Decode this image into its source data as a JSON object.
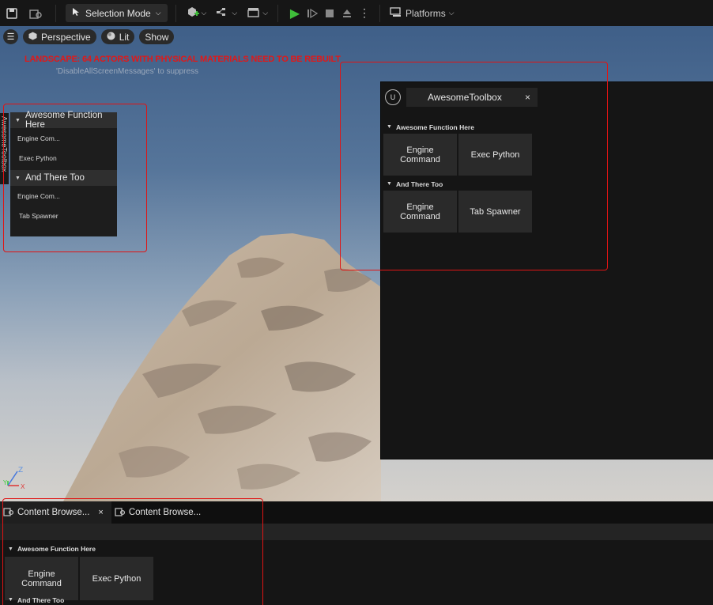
{
  "toolbar": {
    "mode_label": "Selection Mode",
    "platforms_label": "Platforms"
  },
  "viewport": {
    "perspective_label": "Perspective",
    "lit_label": "Lit",
    "show_label": "Show",
    "warning": "LANDSCAPE: 64 ACTORS WITH PHYSICAL MATERIALS NEED TO BE REBUILT",
    "warning_sub": "'DisableAllScreenMessages' to suppress",
    "side_tab_label": "AwesomeToolbox",
    "axis_z": "Z",
    "axis_y": "Y",
    "axis_x": "X"
  },
  "mini_panel": {
    "section1": "Awesome Function Here",
    "items1": [
      "Engine Com...",
      "Exec Python"
    ],
    "section2": "And There Too",
    "items2": [
      "Engine Com...",
      "Tab Spawner"
    ]
  },
  "float_window": {
    "tab_title": "AwesomeToolbox",
    "close": "×",
    "section1": "Awesome Function Here",
    "buttons1": [
      "Engine\nCommand",
      "Exec Python"
    ],
    "section2": "And There Too",
    "buttons2": [
      "Engine\nCommand",
      "Tab Spawner"
    ]
  },
  "bottom_panel": {
    "tabs": [
      "Content Browse...",
      "Content Browse..."
    ],
    "close": "×",
    "section1": "Awesome Function Here",
    "buttons1": [
      "Engine\nCommand",
      "Exec Python"
    ],
    "section2": "And There Too"
  },
  "colors": {
    "highlight": "#e01414",
    "play": "#3fbf3a",
    "warning": "#e01919"
  }
}
